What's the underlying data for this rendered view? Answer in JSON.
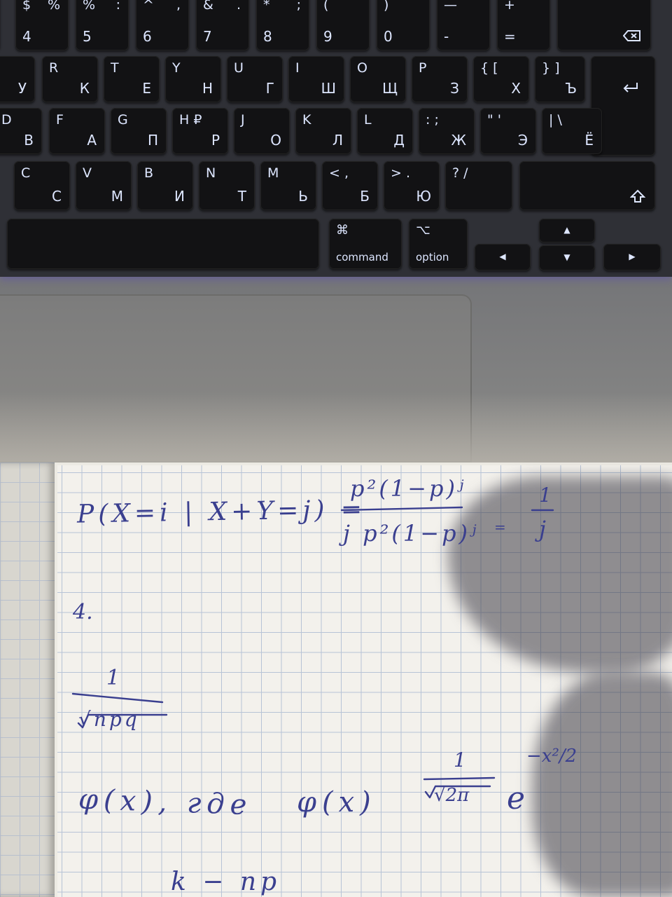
{
  "keyboard": {
    "number_row": [
      {
        "top": "$",
        "bottom": "4",
        "top2": "%"
      },
      {
        "top": "%",
        "bottom": "5",
        "top2": ":"
      },
      {
        "top": "^",
        "bottom": "6",
        "top2": ","
      },
      {
        "top": "&",
        "bottom": "7",
        "top2": "."
      },
      {
        "top": "*",
        "bottom": "8",
        "top2": ";"
      },
      {
        "top": "(",
        "bottom": "9",
        "top2": ""
      },
      {
        "top": ")",
        "bottom": "0",
        "top2": ""
      },
      {
        "top": "—",
        "bottom": "-",
        "top2": ""
      },
      {
        "top": "+",
        "bottom": "=",
        "top2": ""
      }
    ],
    "qwerty_row": [
      {
        "latin": "",
        "cyr": "У"
      },
      {
        "latin": "R",
        "cyr": "К"
      },
      {
        "latin": "T",
        "cyr": "Е"
      },
      {
        "latin": "Y",
        "cyr": "Н"
      },
      {
        "latin": "U",
        "cyr": "Г"
      },
      {
        "latin": "I",
        "cyr": "Ш"
      },
      {
        "latin": "O",
        "cyr": "Щ"
      },
      {
        "latin": "P",
        "cyr": "З"
      },
      {
        "latin": "{ [",
        "cyr": "Х"
      },
      {
        "latin": "} ]",
        "cyr": "Ъ"
      }
    ],
    "home_row": [
      {
        "latin": "D",
        "cyr": "В"
      },
      {
        "latin": "F",
        "cyr": "А"
      },
      {
        "latin": "G",
        "cyr": "П"
      },
      {
        "latin": "H ₽",
        "cyr": "Р"
      },
      {
        "latin": "J",
        "cyr": "О"
      },
      {
        "latin": "K",
        "cyr": "Л"
      },
      {
        "latin": "L",
        "cyr": "Д"
      },
      {
        "latin": ": ;",
        "cyr": "Ж"
      },
      {
        "latin": "\" '",
        "cyr": "Э"
      },
      {
        "latin": "| \\",
        "cyr": "Ё"
      }
    ],
    "bottom_row": [
      {
        "latin": "C",
        "cyr": "С"
      },
      {
        "latin": "V",
        "cyr": "М"
      },
      {
        "latin": "B",
        "cyr": "И"
      },
      {
        "latin": "N",
        "cyr": "Т"
      },
      {
        "latin": "M",
        "cyr": "Ь"
      },
      {
        "latin": "< ,",
        "cyr": "Б"
      },
      {
        "latin": "> .",
        "cyr": "Ю"
      },
      {
        "latin": "? /",
        "cyr": ""
      }
    ],
    "command": {
      "glyph": "⌘",
      "label": "command"
    },
    "option": {
      "glyph": "⌥",
      "label": "option"
    },
    "delete_icon": "delete-icon",
    "return_icon": "return-icon",
    "shift_icon": "shift-icon",
    "arrows": {
      "up": "▲",
      "down": "▼",
      "left": "◀",
      "right": "▶"
    }
  },
  "notebook": {
    "line1": {
      "lhs": "P(X=i | X+Y=j) =",
      "numerator": "p²(1−p)ʲ",
      "denominator": "j p²(1−p)ʲ",
      "eq": "=",
      "result_num": "1",
      "result_den": "j"
    },
    "item_number": "4.",
    "fraction": {
      "num": "1",
      "den": "√npq"
    },
    "line3": {
      "left": "φ(x), где",
      "right": "φ(x)",
      "coef_num": "1",
      "coef_den": "√2π",
      "base": "e",
      "exp": "−x²/2"
    },
    "line4": "k − np"
  },
  "colors": {
    "ink": "#3a3f8f",
    "key_legend": "#dde6ff",
    "paper": "#f3f1ec"
  }
}
